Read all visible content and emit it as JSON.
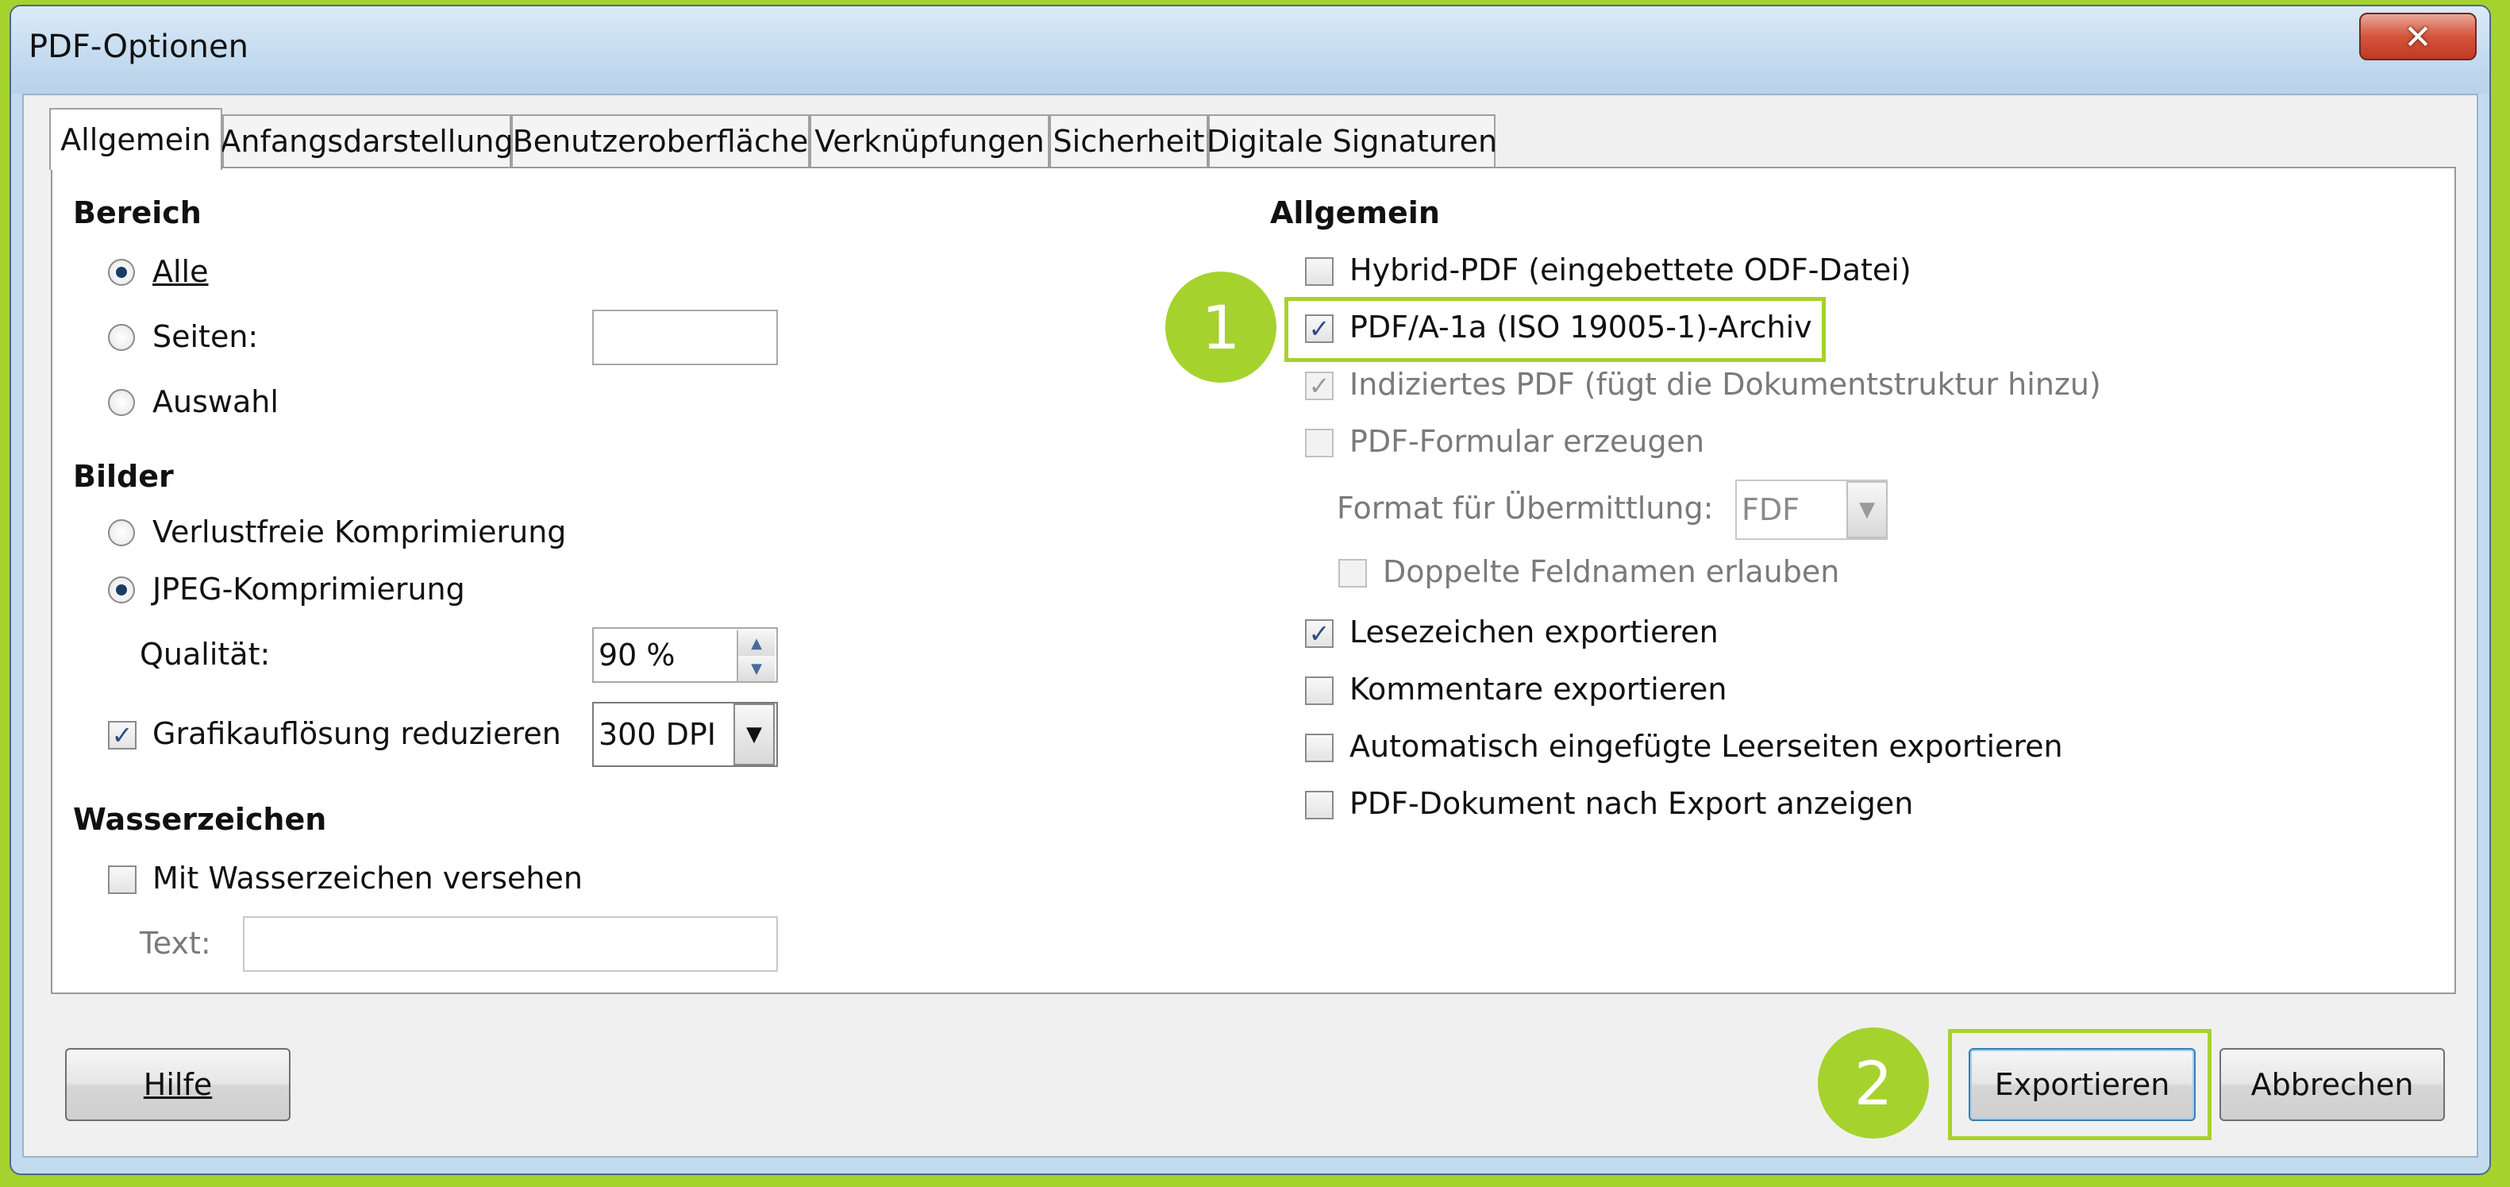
{
  "window": {
    "title": "PDF-Optionen",
    "close_glyph": "✕"
  },
  "tabs": [
    "Allgemein",
    "Anfangsdarstellung",
    "Benutzeroberfläche",
    "Verknüpfungen",
    "Sicherheit",
    "Digitale Signaturen"
  ],
  "bereich": {
    "title": "Bereich",
    "alle": "Alle",
    "seiten": "Seiten:",
    "auswahl": "Auswahl",
    "seiten_value": ""
  },
  "bilder": {
    "title": "Bilder",
    "verlustfrei": "Verlustfreie Komprimierung",
    "jpeg": "JPEG-Komprimierung",
    "qualitaet_label": "Qualität:",
    "qualitaet_value": "90 %",
    "grafik_label": "Grafikauflösung reduzieren",
    "dpi_value": "300 DPI"
  },
  "wasserzeichen": {
    "title": "Wasserzeichen",
    "mit": "Mit Wasserzeichen versehen",
    "text_label": "Text:",
    "text_value": ""
  },
  "allgemein": {
    "title": "Allgemein",
    "hybrid": "Hybrid-PDF (eingebettete ODF-Datei)",
    "pdfa": "PDF/A-1a (ISO 19005-1)-Archiv",
    "indiziert": "Indiziertes PDF (fügt die Dokumentstruktur hinzu)",
    "formular": "PDF-Formular erzeugen",
    "format_label": "Format für Übermittlung:",
    "format_value": "FDF",
    "doppelte": "Doppelte Feldnamen erlauben",
    "lesezeichen": "Lesezeichen exportieren",
    "kommentare": "Kommentare exportieren",
    "leerseiten": "Automatisch eingefügte Leerseiten exportieren",
    "anzeigen": "PDF-Dokument nach Export anzeigen"
  },
  "buttons": {
    "hilfe": "Hilfe",
    "exportieren": "Exportieren",
    "abbrechen": "Abbrechen"
  },
  "callouts": {
    "one": "1",
    "two": "2"
  },
  "glyphs": {
    "check": "✓",
    "up": "▲",
    "down": "▼"
  },
  "colors": {
    "accent": "#a6d22e"
  }
}
